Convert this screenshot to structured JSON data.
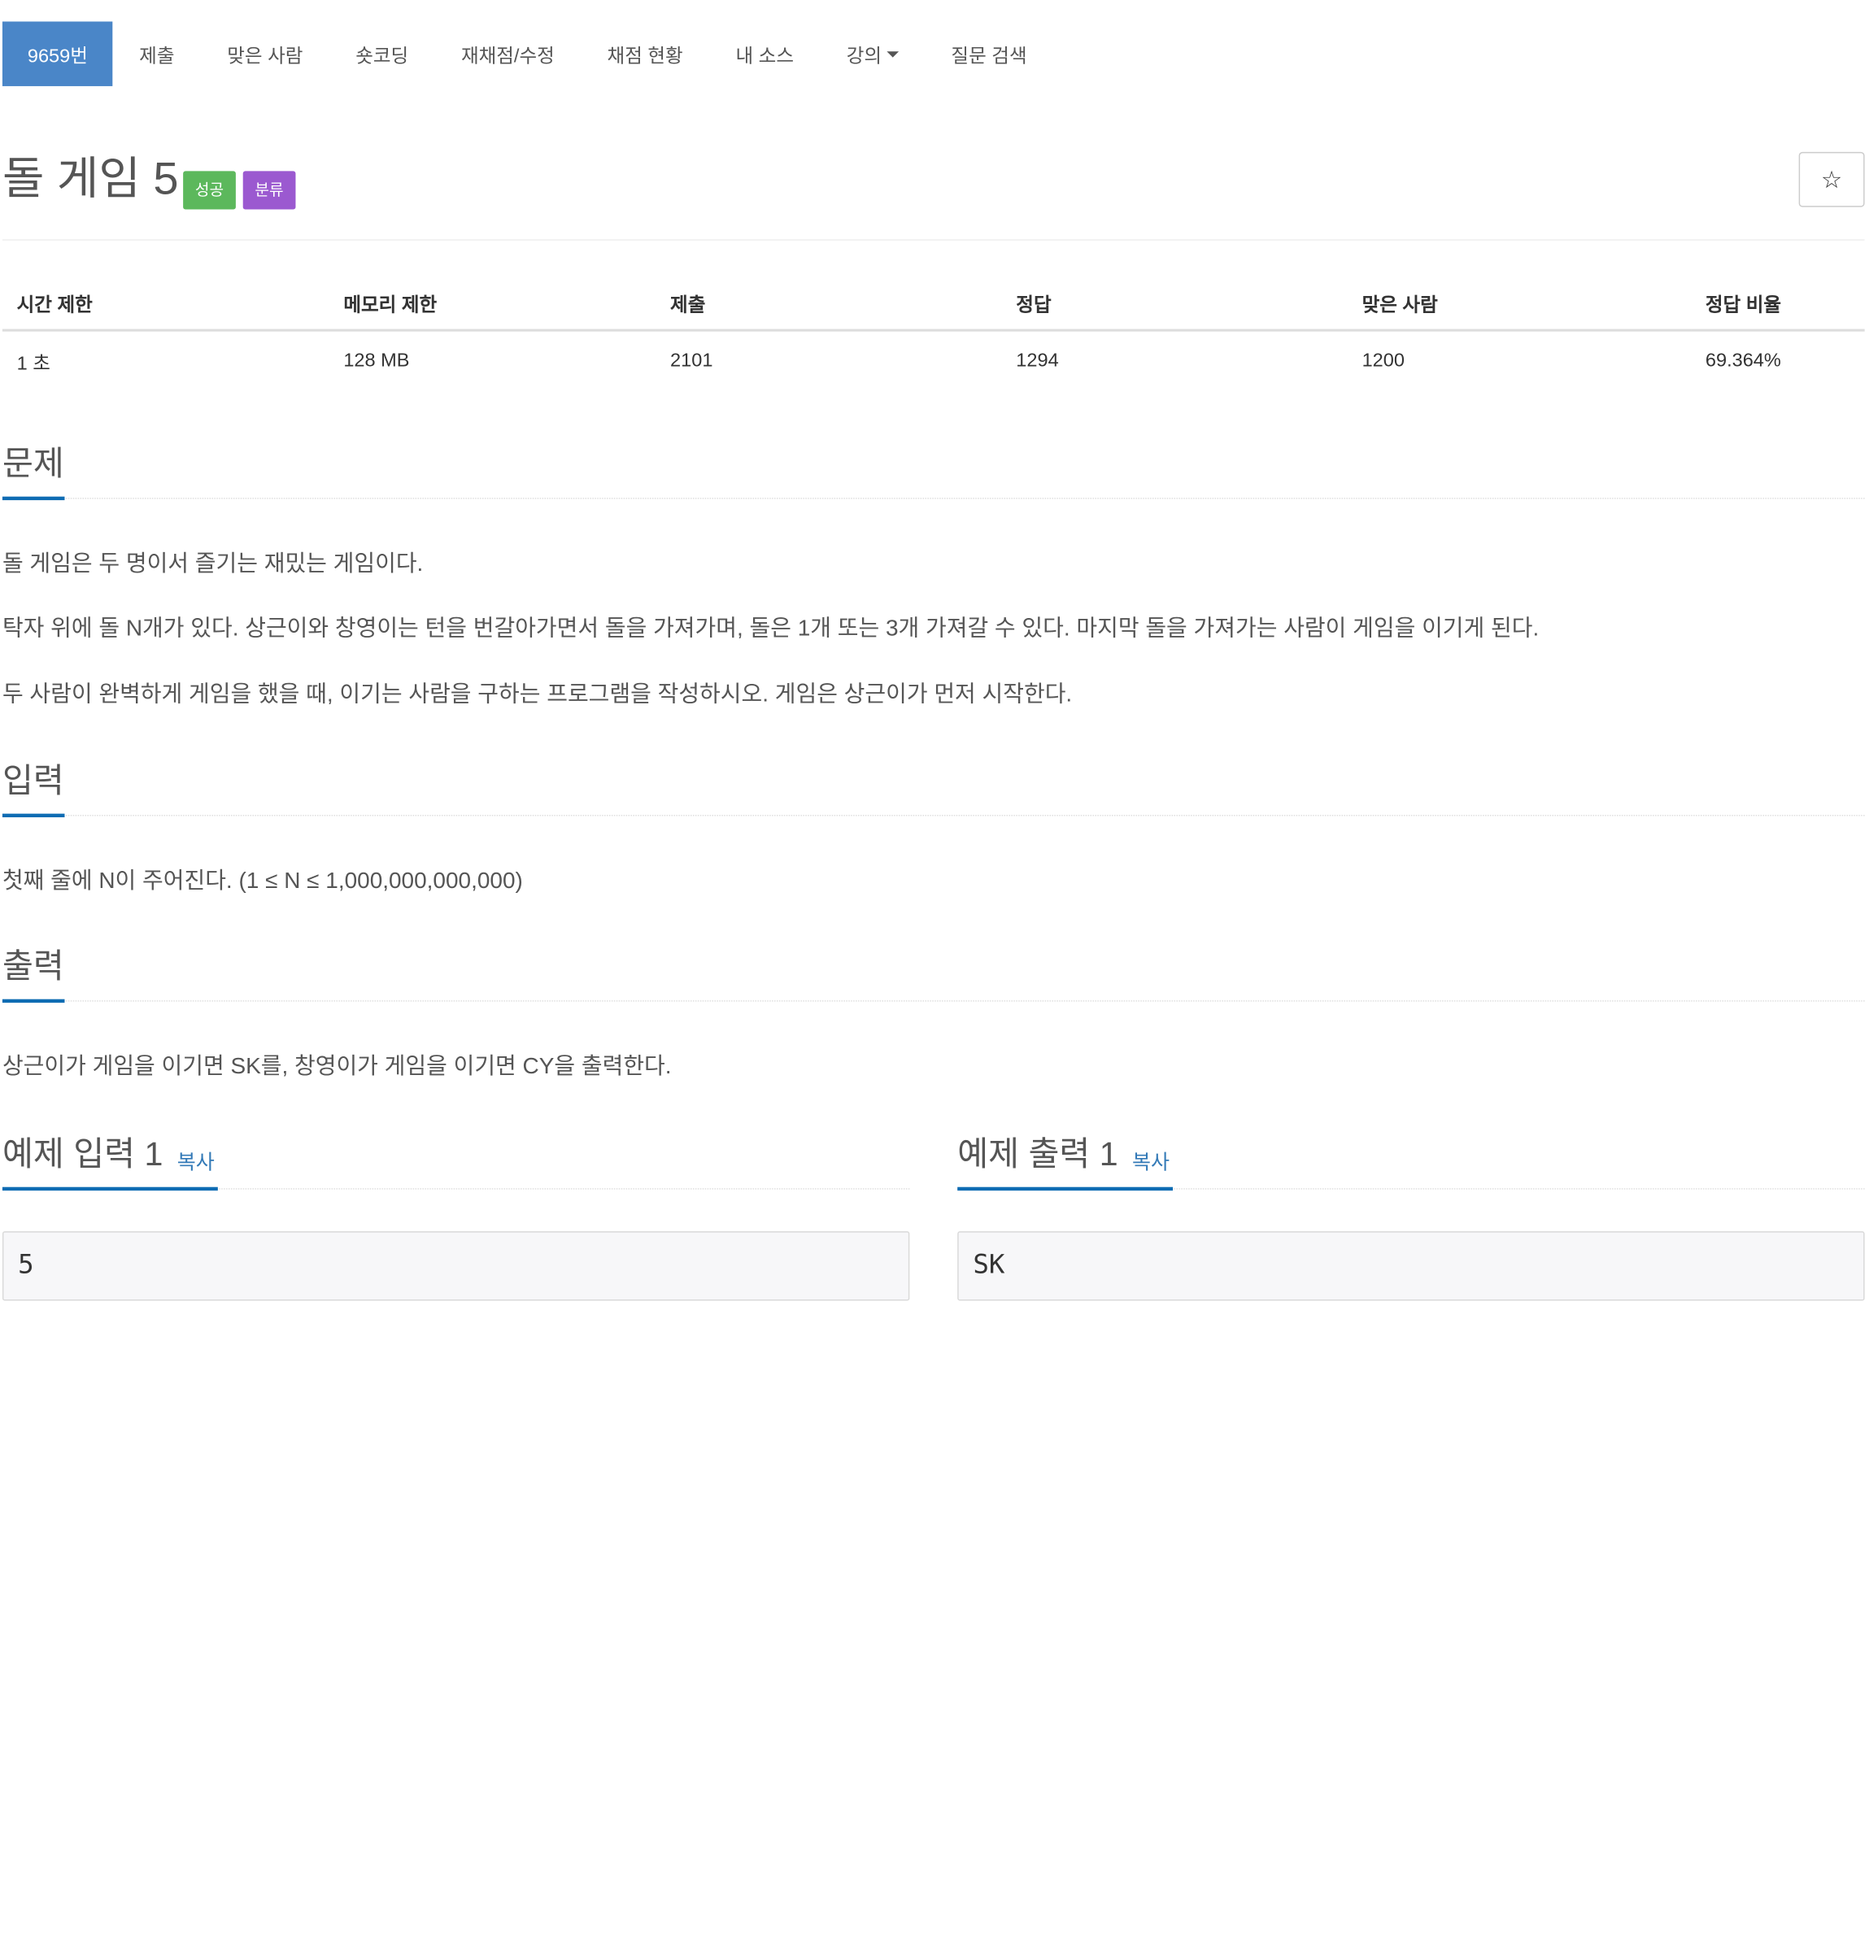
{
  "nav": {
    "tabs": [
      {
        "label": "9659번",
        "active": true
      },
      {
        "label": "제출"
      },
      {
        "label": "맞은 사람"
      },
      {
        "label": "숏코딩"
      },
      {
        "label": "재채점/수정"
      },
      {
        "label": "채점 현황"
      },
      {
        "label": "내 소스"
      },
      {
        "label": "강의",
        "dropdown": true
      },
      {
        "label": "질문 검색"
      }
    ]
  },
  "problem": {
    "title": "돌 게임 5",
    "badges": {
      "success": "성공",
      "category": "분류"
    },
    "star": "☆"
  },
  "stats": {
    "headers": [
      "시간 제한",
      "메모리 제한",
      "제출",
      "정답",
      "맞은 사람",
      "정답 비율"
    ],
    "values": [
      "1 초",
      "128 MB",
      "2101",
      "1294",
      "1200",
      "69.364%"
    ]
  },
  "sections": {
    "problem": {
      "heading": "문제",
      "paragraphs": [
        "돌 게임은 두 명이서 즐기는 재밌는 게임이다.",
        "탁자 위에 돌 N개가 있다. 상근이와 창영이는 턴을 번갈아가면서 돌을 가져가며, 돌은 1개 또는 3개 가져갈 수 있다. 마지막 돌을 가져가는 사람이 게임을 이기게 된다.",
        "두 사람이 완벽하게 게임을 했을 때, 이기는 사람을 구하는 프로그램을 작성하시오. 게임은 상근이가 먼저 시작한다."
      ]
    },
    "input": {
      "heading": "입력",
      "text": "첫째 줄에 N이 주어진다. (1 ≤ N ≤ 1,000,000,000,000)"
    },
    "output": {
      "heading": "출력",
      "text": "상근이가 게임을 이기면 SK를, 창영이가 게임을 이기면 CY을 출력한다."
    },
    "sample_input": {
      "heading": "예제 입력 1",
      "copy": "복사",
      "value": "5"
    },
    "sample_output": {
      "heading": "예제 출력 1",
      "copy": "복사",
      "value": "SK"
    }
  },
  "colors": {
    "accent": "#4a86c8",
    "success": "#5cb85c",
    "category": "#9b59d0",
    "link": "#337ab7"
  }
}
